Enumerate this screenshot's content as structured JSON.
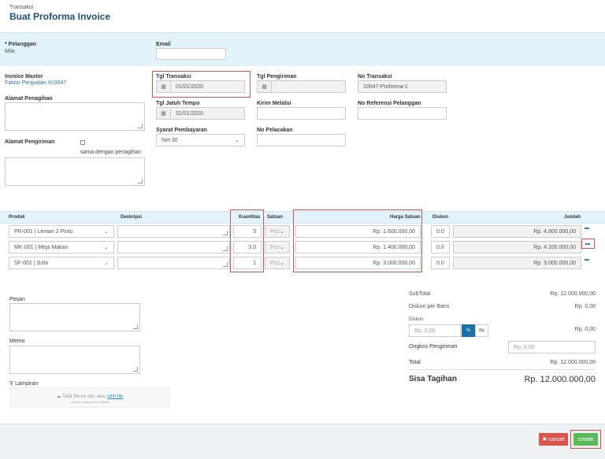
{
  "header": {
    "breadcrumb": "Transaksi",
    "title": "Buat Proforma Invoice"
  },
  "customer": {
    "label": "* Pelanggan",
    "value": "Mila"
  },
  "email": {
    "label": "Email",
    "value": ""
  },
  "invoice_master": {
    "label": "Invoice Master",
    "value": "Faktur Penjualan #10047"
  },
  "billing_address": {
    "label": "Alamat Penagihan"
  },
  "shipping_address": {
    "label": "Alamat Pengiriman",
    "same_label": "sama dengan penagihan"
  },
  "fields": {
    "tgl_transaksi": {
      "label": "Tgl Transaksi",
      "value": "01/01/2020"
    },
    "tgl_pengiriman": {
      "label": "Tgl Pengiriman",
      "value": ""
    },
    "no_transaksi": {
      "label": "No Transaksi",
      "value": "10047-Proforma-1"
    },
    "tgl_jatuh_tempo": {
      "label": "Tgl Jatuh Tempo",
      "value": "31/01/2020"
    },
    "kirim_melalui": {
      "label": "Kirim Melalui",
      "value": ""
    },
    "no_referensi": {
      "label": "No Referensi Pelanggan",
      "value": ""
    },
    "syarat_pembayaran": {
      "label": "Syarat Pembayaran",
      "value": "Net 30"
    },
    "no_pelacakan": {
      "label": "No Pelacakan",
      "value": ""
    }
  },
  "table": {
    "headers": {
      "produk": "Produk",
      "deskripsi": "Deskripsi",
      "kuantitas": "Kuantitas",
      "satuan": "Satuan",
      "harga": "Harga Satuan",
      "diskon": "Diskon",
      "jumlah": "Jumlah"
    },
    "rows": [
      {
        "produk": "PR-001 | Lemari 2 Pintu",
        "qty": "3",
        "satuan": "Pcs",
        "harga": "Rp. 1.600.000,00",
        "diskon": "0.0",
        "jumlah": "Rp. 4.800.000,00"
      },
      {
        "produk": "MK-001 | Meja Makan",
        "qty": "3.0",
        "satuan": "Pcs",
        "harga": "Rp. 1.400.000,00",
        "diskon": "0.0",
        "jumlah": "Rp. 4.200.000,00"
      },
      {
        "produk": "SF-001 | Sofa",
        "qty": "1",
        "satuan": "Pcs",
        "harga": "Rp. 3.000.000,00",
        "diskon": "0.0",
        "jumlah": "Rp. 3.000.000,00"
      }
    ]
  },
  "notes": {
    "pesan": "Pesan",
    "memo": "Memo",
    "lampiran": "Lampiran",
    "upload_text": "Tarik file ke sini, atau",
    "upload_link": "pilih file",
    "upload_hint": "ukuran maksimal 10 MB/file"
  },
  "summary": {
    "subtotal_label": "SubTotal",
    "subtotal_value": "Rp. 12.000.000,00",
    "diskon_baris_label": "Diskon per Baris",
    "diskon_baris_value": "Rp. 0,00",
    "diskon_label": "Diskon",
    "diskon_input": "Rp. 0,00",
    "pct": "%",
    "rp": "Rp",
    "diskon_value": "Rp. 0,00",
    "ongkos_label": "Ongkos Pengiriman",
    "ongkos_input": "Rp. 0,00",
    "total_label": "Total",
    "total_value": "Rp. 12.000.000,00",
    "sisa_label": "Sisa Tagihan",
    "sisa_value": "Rp. 12.000.000,00"
  },
  "footer": {
    "cancel": "cancel",
    "create": "create"
  },
  "colors": {
    "accent": "#1d6fa5",
    "band": "#e2f3fb",
    "danger": "#d9534f",
    "success": "#5cb85c"
  }
}
